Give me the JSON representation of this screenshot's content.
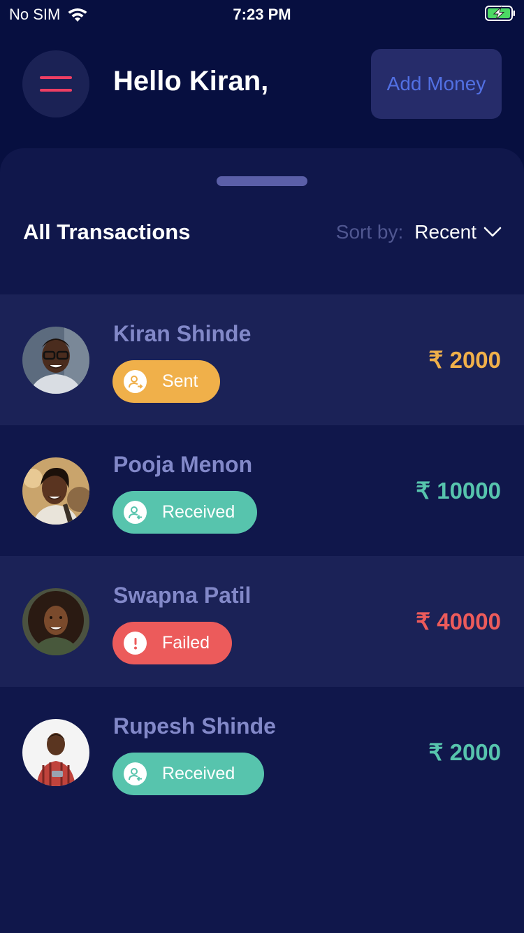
{
  "status_bar": {
    "carrier": "No SIM",
    "time": "7:23 PM"
  },
  "header": {
    "greeting": "Hello Kiran,",
    "add_money_label": "Add Money"
  },
  "transactions": {
    "title": "All Transactions",
    "sort_label": "Sort by:",
    "sort_value": "Recent",
    "items": [
      {
        "name": "Kiran Shinde",
        "status": "Sent",
        "amount": "₹ 2000",
        "status_color": "#f0b04a",
        "amount_color": "#f0b04a",
        "icon": "user-send-icon"
      },
      {
        "name": "Pooja Menon",
        "status": "Received",
        "amount": "₹ 10000",
        "status_color": "#57c4ad",
        "amount_color": "#57c4ad",
        "icon": "user-receive-icon"
      },
      {
        "name": "Swapna Patil",
        "status": "Failed",
        "amount": "₹ 40000",
        "status_color": "#ec5b5b",
        "amount_color": "#ec5b5b",
        "icon": "alert-icon"
      },
      {
        "name": "Rupesh Shinde",
        "status": "Received",
        "amount": "₹ 2000",
        "status_color": "#57c4ad",
        "amount_color": "#57c4ad",
        "icon": "user-receive-icon"
      }
    ]
  },
  "colors": {
    "background": "#070f40",
    "sheet": "#10174b",
    "row_shaded": "#1b2257",
    "accent_menu": "#ee3e63",
    "add_money_text": "#5270e3"
  }
}
